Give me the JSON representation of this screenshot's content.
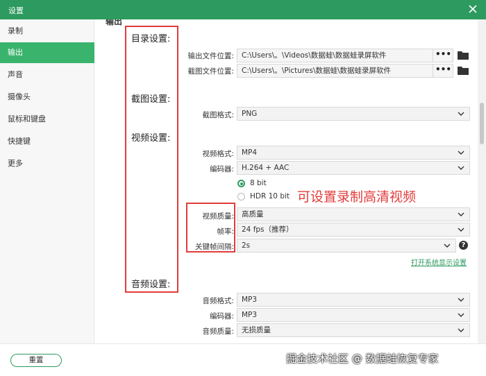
{
  "window": {
    "title": "设置"
  },
  "sidebar": {
    "items": [
      {
        "label": "录制"
      },
      {
        "label": "输出"
      },
      {
        "label": "声音"
      },
      {
        "label": "摄像头"
      },
      {
        "label": "鼠标和键盘"
      },
      {
        "label": "快捷键"
      },
      {
        "label": "更多"
      }
    ],
    "active_index": 1
  },
  "main": {
    "section_heading": "输出",
    "sections": {
      "directory": "目录设置:",
      "screenshot": "截图设置:",
      "video": "视频设置:",
      "audio": "音频设置:"
    },
    "output_path": {
      "label": "输出文件位置:",
      "value": "C:\\Users\\。\\Videos\\数据蛙\\数据蛙录屏软件",
      "browse": "•••"
    },
    "screenshot_path": {
      "label": "截图文件位置:",
      "value": "C:\\Users\\。\\Pictures\\数据蛙\\数据蛙录屏软件",
      "browse": "•••"
    },
    "screenshot_format": {
      "label": "截图格式:",
      "value": "PNG"
    },
    "video_format": {
      "label": "视频格式:",
      "value": "MP4"
    },
    "video_encoder": {
      "label": "编码器:",
      "value": "H.264 + AAC"
    },
    "bit_depth": {
      "options": [
        "8 bit",
        "HDR 10 bit"
      ],
      "selected": "8 bit"
    },
    "video_quality": {
      "label": "视频质量:",
      "value": "高质量"
    },
    "frame_rate": {
      "label": "帧率:",
      "value": "24 fps（推荐）"
    },
    "keyframe_interval": {
      "label": "关键帧间隔:",
      "value": "2s"
    },
    "help": "?",
    "display_settings_link": "打开系统显示设置",
    "audio_format": {
      "label": "音频格式:",
      "value": "MP3"
    },
    "audio_encoder": {
      "label": "编码器:",
      "value": "MP3"
    },
    "audio_quality": {
      "label": "音频质量:",
      "value": "无损质量"
    }
  },
  "annotation": {
    "text": "可设置录制高清视频",
    "color": "#e23b3b"
  },
  "footer": {
    "reset_label": "重置",
    "watermark": "掘金技术社区 @ 数据蛙恢复专家"
  },
  "colors": {
    "accent": "#2d9a5f",
    "active_item": "#3ab36d",
    "annotation": "#e23b3b"
  }
}
